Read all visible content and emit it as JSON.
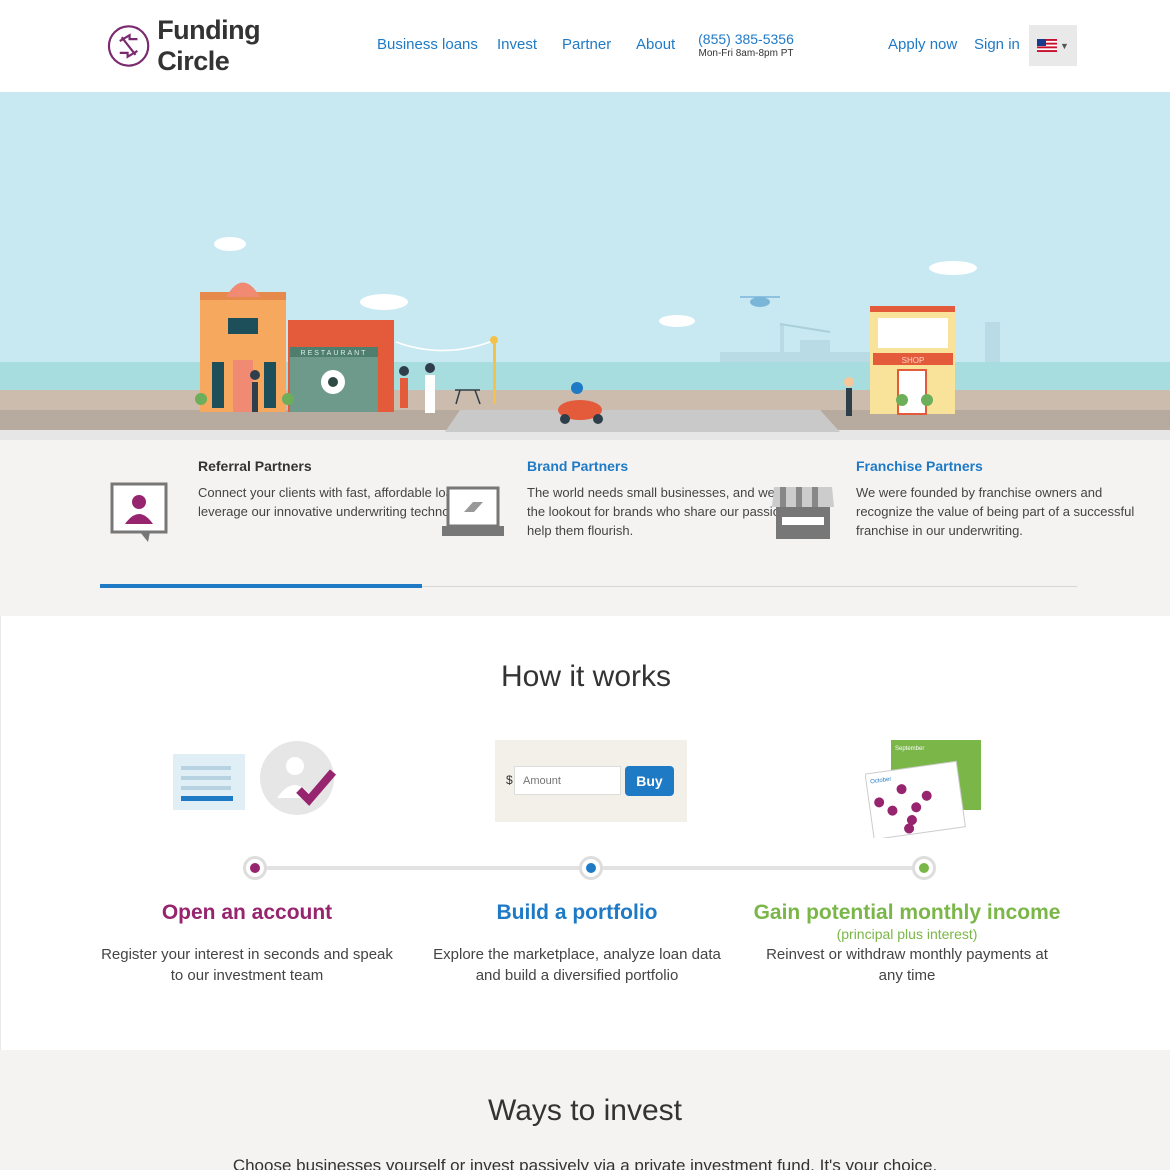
{
  "header": {
    "logo_text": "Funding Circle",
    "nav": [
      "Business loans",
      "Invest",
      "Partner",
      "About"
    ],
    "phone": "(855) 385-5356",
    "phone_hours": "Mon-Fri 8am-8pm PT",
    "apply": "Apply now",
    "signin": "Sign in",
    "locale_icon": "us-flag-icon"
  },
  "hero": {
    "restaurant_sign": "RESTAURANT",
    "shop_sign": "SHOP"
  },
  "partners": [
    {
      "title": "Referral Partners",
      "text": "Connect your clients with fast, affordable loans or leverage our innovative underwriting technology.",
      "icon": "referral-icon",
      "active": true
    },
    {
      "title": "Brand Partners",
      "text": "The world needs small businesses, and we are on the lookout for brands who share our passion to help them flourish.",
      "icon": "laptop-icon",
      "active": false
    },
    {
      "title": "Franchise Partners",
      "text": "We were founded by franchise owners and recognize the value of being part of a successful franchise in our underwriting.",
      "icon": "storefront-icon",
      "active": false
    }
  ],
  "how": {
    "title": "How it works",
    "amount_symbol": "$",
    "amount_placeholder": "Amount",
    "buy_label": "Buy",
    "calendar_months": [
      "September",
      "October"
    ],
    "steps": [
      {
        "title": "Open an account",
        "subtitle": "",
        "desc": "Register your interest in seconds and speak to our investment team",
        "color": "#97246e"
      },
      {
        "title": "Build a portfolio",
        "subtitle": "",
        "desc": "Explore the marketplace, analyze loan data and build a diversified portfolio",
        "color": "#1f7ac6"
      },
      {
        "title": "Gain potential monthly income",
        "subtitle": "(principal plus interest)",
        "desc": "Reinvest or withdraw monthly payments at any time",
        "color": "#7ab648"
      }
    ]
  },
  "ways": {
    "title": "Ways to invest",
    "text": "Choose businesses yourself or invest passively via a private investment fund. It's your choice."
  },
  "colors": {
    "brand_blue": "#1f7ac6",
    "brand_purple": "#97246e",
    "brand_green": "#7ab648"
  }
}
